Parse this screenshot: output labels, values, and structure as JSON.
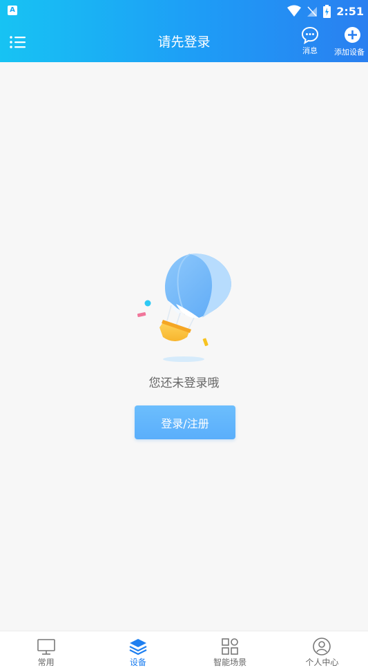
{
  "status_bar": {
    "time": "2:51",
    "app_icon_letter": "A"
  },
  "header": {
    "title": "请先登录",
    "message_label": "消息",
    "add_device_label": "添加设备"
  },
  "empty_state": {
    "text": "您还未登录哦",
    "login_button_label": "登录/注册"
  },
  "tab_bar": {
    "tabs": [
      {
        "label": "常用",
        "icon": "monitor-icon",
        "active": false
      },
      {
        "label": "设备",
        "icon": "layers-icon",
        "active": true
      },
      {
        "label": "智能场景",
        "icon": "grid-icon",
        "active": false
      },
      {
        "label": "个人中心",
        "icon": "user-circle-icon",
        "active": false
      }
    ]
  },
  "colors": {
    "header_gradient_start": "#17c3f3",
    "header_gradient_end": "#2a7ff0",
    "active_tab": "#1e7ff0",
    "button": "#5aaefb",
    "background": "#f7f7f7"
  }
}
